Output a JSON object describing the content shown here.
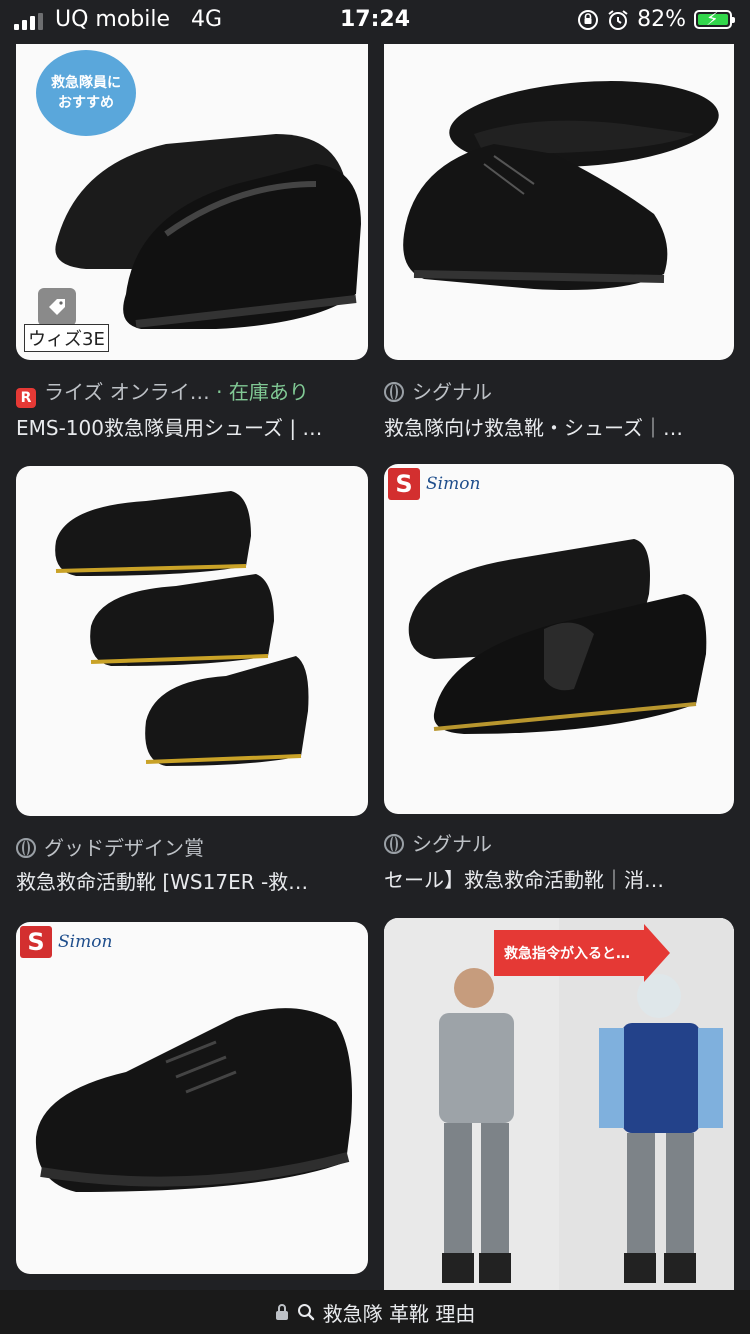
{
  "status_bar": {
    "carrier": "UQ mobile",
    "network": "4G",
    "time": "17:24",
    "battery_percent": "82%"
  },
  "results": [
    {
      "source": "ライズ オンライ…",
      "stock": "· 在庫あり",
      "title": "EMS-100救急隊員用シューズ | …",
      "badge_line1": "救急隊員に",
      "badge_line2": "おすすめ",
      "size_label": "ウィズ3E"
    },
    {
      "source": "シグナル",
      "title": "救急隊向け救急靴・シューズ｜…"
    },
    {
      "source": "グッドデザイン賞",
      "title": "救急救命活動靴 [WS17ER -救…"
    },
    {
      "source": "シグナル",
      "title": "セール】救急救命活動靴｜消…",
      "brand": "Simon"
    },
    {
      "brand": "Simon"
    },
    {
      "sign_text": "救急指令が入ると…"
    }
  ],
  "url_bar": {
    "query": "救急隊 革靴 理由"
  },
  "colors": {
    "background": "#202124",
    "stock_green": "#81c995",
    "battery_green": "#32d74b"
  }
}
